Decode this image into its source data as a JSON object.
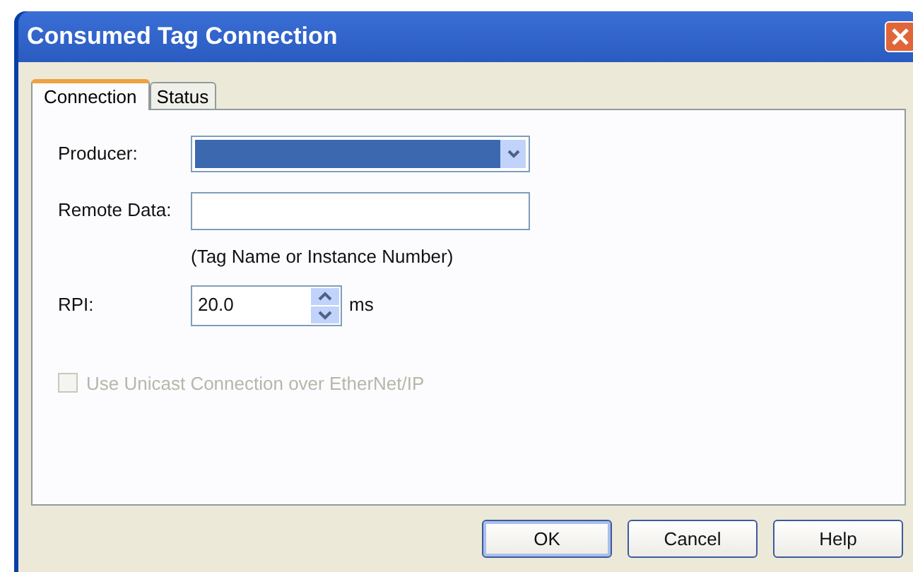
{
  "window": {
    "title": "Consumed Tag Connection"
  },
  "tabs": [
    {
      "label": "Connection",
      "selected": true
    },
    {
      "label": "Status",
      "selected": false
    }
  ],
  "producer": {
    "label": "Producer:",
    "focused": true
  },
  "remote_data": {
    "label": "Remote Data:",
    "hint": "(Tag Name or Instance Number)"
  },
  "rpi": {
    "label": "RPI:",
    "value": "20.0",
    "unit": "ms"
  },
  "unicast": {
    "label": "Use Unicast Connection over EtherNet/IP",
    "checked": false,
    "disabled": true
  },
  "buttons": [
    {
      "label": "OK",
      "default": true
    },
    {
      "label": "Cancel",
      "default": false
    },
    {
      "label": "Help",
      "default": false
    }
  ]
}
